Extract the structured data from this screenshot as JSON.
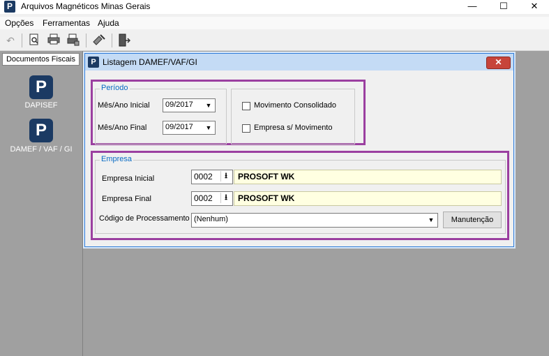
{
  "window": {
    "title": "Arquivos Magnéticos Minas Gerais",
    "icon_letter": "P"
  },
  "window_controls": {
    "minimize": "—",
    "maximize": "☐",
    "close": "✕"
  },
  "menu": [
    "Opções",
    "Ferramentas",
    "Ajuda"
  ],
  "toolbar": {
    "icons": [
      "undo-icon",
      "print-preview-icon",
      "print-icon",
      "print-setup-icon",
      "tools-icon",
      "exit-icon"
    ]
  },
  "sidebar": {
    "header": "Documentos Fiscais",
    "items": [
      {
        "label": "DAPISEF",
        "icon_letter": "P"
      },
      {
        "label": "DAMEF / VAF / GI",
        "icon_letter": "P"
      }
    ]
  },
  "dialog": {
    "title": "Listagem DAMEF/VAF/GI",
    "icon_letter": "P",
    "close": "✕",
    "periodo": {
      "legend": "Período",
      "inicial_label": "Mês/Ano Inicial",
      "inicial_value": "09/2017",
      "final_label": "Mês/Ano Final",
      "final_value": "09/2017"
    },
    "options": {
      "movimento_consolidado": "Movimento Consolidado",
      "movimento_consolidado_checked": false,
      "empresa_sem_movimento": "Empresa s/ Movimento",
      "empresa_sem_movimento_checked": false
    },
    "empresa": {
      "legend": "Empresa",
      "inicial_label": "Empresa Inicial",
      "inicial_code": "0002",
      "inicial_name": "PROSOFT WK",
      "final_label": "Empresa Final",
      "final_code": "0002",
      "final_name": "PROSOFT WK",
      "processamento_label": "Código de Processamento",
      "processamento_value": "(Nenhum)",
      "manutencao_button": "Manutenção"
    }
  },
  "colors": {
    "highlight": "#9b3fa0",
    "legend": "#0a6cc4",
    "name_field_bg": "#ffffe1"
  }
}
